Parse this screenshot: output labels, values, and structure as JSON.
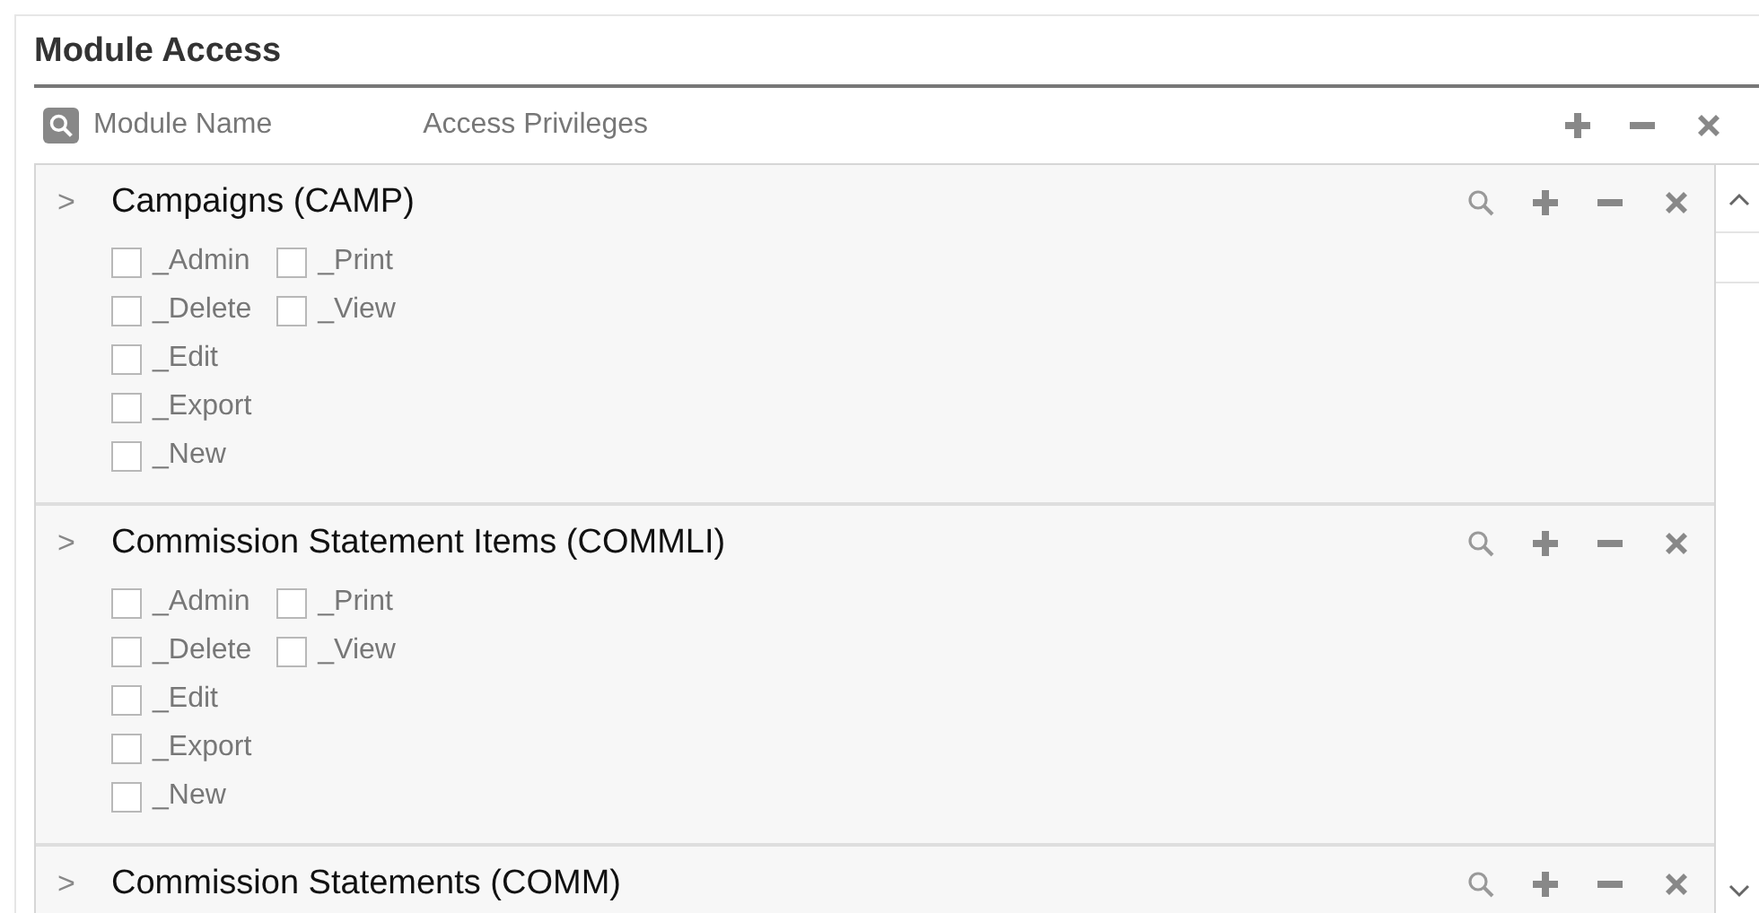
{
  "title": "Module Access",
  "columns": [
    "Module Name",
    "Access Privileges"
  ],
  "modules": [
    {
      "name": "Campaigns  (CAMP)",
      "toggle": ">",
      "privilege_columns": [
        [
          {
            "label": "_Admin",
            "checked": false
          },
          {
            "label": "_Delete",
            "checked": false
          },
          {
            "label": "_Edit",
            "checked": false
          },
          {
            "label": "_Export",
            "checked": false
          },
          {
            "label": "_New",
            "checked": false
          }
        ],
        [
          {
            "label": "_Print",
            "checked": false
          },
          {
            "label": "_View",
            "checked": false
          }
        ]
      ]
    },
    {
      "name": "Commission Statement Items  (COMMLI)",
      "toggle": ">",
      "privilege_columns": [
        [
          {
            "label": "_Admin",
            "checked": false
          },
          {
            "label": "_Delete",
            "checked": false
          },
          {
            "label": "_Edit",
            "checked": false
          },
          {
            "label": "_Export",
            "checked": false
          },
          {
            "label": "_New",
            "checked": false
          }
        ],
        [
          {
            "label": "_Print",
            "checked": false
          },
          {
            "label": "_View",
            "checked": false
          }
        ]
      ]
    },
    {
      "name": "Commission Statements  (COMM)",
      "toggle": ">"
    }
  ]
}
